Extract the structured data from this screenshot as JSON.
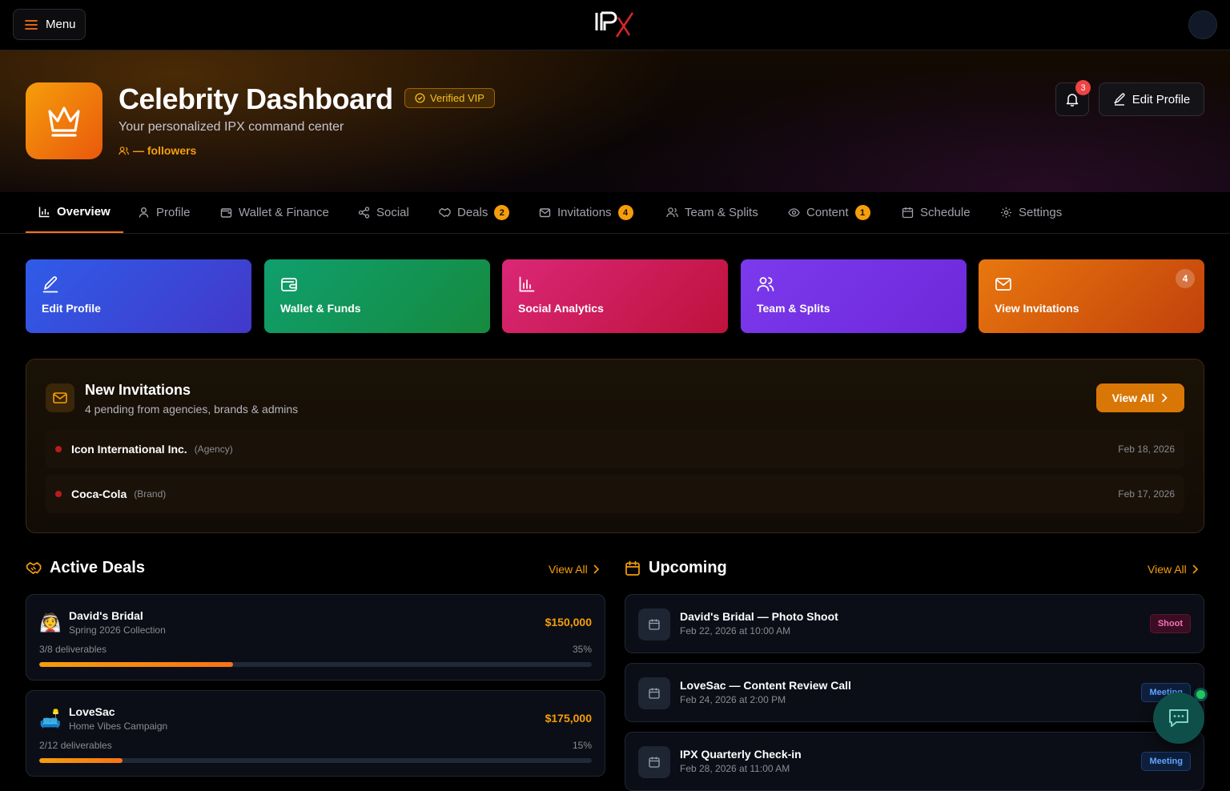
{
  "topbar": {
    "menu_label": "Menu",
    "logo_text": "IPX"
  },
  "hero": {
    "title": "Celebrity Dashboard",
    "badge": "Verified VIP",
    "subtitle": "Your personalized IPX command center",
    "followers": "— followers",
    "notification_count": "3",
    "edit_label": "Edit Profile"
  },
  "tabs": [
    {
      "label": "Overview",
      "icon": "bar-chart-icon",
      "active": true
    },
    {
      "label": "Profile",
      "icon": "user-icon"
    },
    {
      "label": "Wallet & Finance",
      "icon": "wallet-icon"
    },
    {
      "label": "Social",
      "icon": "share-icon"
    },
    {
      "label": "Deals",
      "icon": "handshake-icon",
      "badge": "2"
    },
    {
      "label": "Invitations",
      "icon": "mail-icon",
      "badge": "4"
    },
    {
      "label": "Team & Splits",
      "icon": "users-icon"
    },
    {
      "label": "Content",
      "icon": "eye-icon",
      "badge": "1"
    },
    {
      "label": "Schedule",
      "icon": "calendar-icon"
    },
    {
      "label": "Settings",
      "icon": "gear-icon"
    }
  ],
  "quick_actions": [
    {
      "label": "Edit Profile",
      "icon": "pencil-icon",
      "color": "#3b5bdb"
    },
    {
      "label": "Wallet & Funds",
      "icon": "wallet-icon",
      "color": "#16a34a"
    },
    {
      "label": "Social Analytics",
      "icon": "bar-chart-icon",
      "color": "#db2777"
    },
    {
      "label": "Team & Splits",
      "icon": "users-icon",
      "color": "#7c3aed"
    },
    {
      "label": "View Invitations",
      "icon": "mail-icon",
      "color": "#ea580c",
      "badge": "4"
    }
  ],
  "invitations": {
    "title": "New Invitations",
    "subtitle": "4 pending from agencies, brands & admins",
    "view_all": "View All",
    "items": [
      {
        "name": "Icon International Inc.",
        "type": "(Agency)",
        "date": "Feb 18, 2026"
      },
      {
        "name": "Coca-Cola",
        "type": "(Brand)",
        "date": "Feb 17, 2026"
      }
    ]
  },
  "active_deals": {
    "title": "Active Deals",
    "view_all": "View All",
    "items": [
      {
        "emoji": "👰",
        "name": "David's Bridal",
        "campaign": "Spring 2026 Collection",
        "amount": "$150,000",
        "deliverables": "3/8 deliverables",
        "percent": "35%",
        "progress": 0.35
      },
      {
        "emoji": "🛋️",
        "name": "LoveSac",
        "campaign": "Home Vibes Campaign",
        "amount": "$175,000",
        "deliverables": "2/12 deliverables",
        "percent": "15%",
        "progress": 0.15
      }
    ]
  },
  "upcoming": {
    "title": "Upcoming",
    "view_all": "View All",
    "items": [
      {
        "title": "David's Bridal — Photo Shoot",
        "time": "Feb 22, 2026 at 10:00 AM",
        "tag": "Shoot"
      },
      {
        "title": "LoveSac — Content Review Call",
        "time": "Feb 24, 2026 at 2:00 PM",
        "tag": "Meeting"
      },
      {
        "title": "IPX Quarterly Check-in",
        "time": "Feb 28, 2026 at 11:00 AM",
        "tag": "Meeting"
      }
    ]
  }
}
